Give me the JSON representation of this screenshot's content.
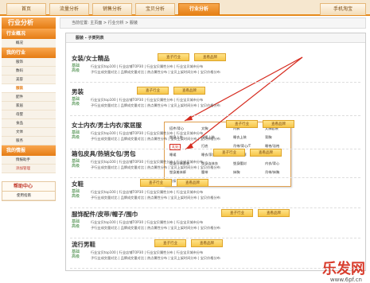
{
  "topnav": {
    "tabs": [
      {
        "label": "首页"
      },
      {
        "label": "流量分析"
      },
      {
        "label": "销售分析"
      },
      {
        "label": "宝贝分析"
      },
      {
        "label": "行业分析"
      },
      {
        "label": "手机淘宝"
      }
    ]
  },
  "breadcrumb": "当前位置: 主页面 > 行业分析 > 服装",
  "sidebar": {
    "title": "行业分析",
    "sections": [
      {
        "heading": "行业概况",
        "items": [
          "概况"
        ]
      },
      {
        "heading": "我的行业",
        "items": [
          "服饰",
          "数码",
          "美容",
          "服装",
          "配件",
          "家居",
          "母婴",
          "食品",
          "文体",
          "服务"
        ]
      },
      {
        "heading": "我的情报",
        "items": [
          "情报助手",
          "添加管理"
        ]
      }
    ],
    "help_title": "帮助中心",
    "help_link": "使用指南"
  },
  "content": {
    "title": "服装 - 子类列表",
    "industry_btn": "查子行业",
    "brand_btn": "查看品牌",
    "basic_label": "基础",
    "advanced_label": "高级",
    "row1": "行业宝贝top100 | 行业店铺TOP30 | 行业宝贝属性分布 | 行业宝贝城市分布",
    "row2": "子行业成交量对比 | 品牌成交量对比 | 热点属性分布 | 宝贝上架时间分布 | 宝贝价格分布",
    "categories": [
      {
        "name": "女装/女士精品"
      },
      {
        "name": "男装"
      },
      {
        "name": "女士内衣/男士内衣/家居服"
      },
      {
        "name": "箱包皮具/热销女包/男包"
      },
      {
        "name": "女鞋"
      },
      {
        "name": "服饰配件/皮带/帽子/围巾"
      },
      {
        "name": "流行男鞋"
      }
    ]
  },
  "dropdown": {
    "items": [
      "搭件/背心",
      "文胸",
      "内裤",
      "文胸套装",
      "塑身上衣",
      "保暖上装",
      "睡衣上装",
      "背胸",
      "乳贴",
      "打底",
      "吊带/背心/T",
      "睡袍/浴袍",
      "睡裙",
      "睡衣/家居服",
      "塑身内裤",
      "袜子",
      "塑身分体套装",
      "塑身连体衣",
      "塑身腰封",
      "内衣/背心",
      "塑身美体裤",
      "腰带",
      "抹胸",
      "吊带/抹胸",
      "吊扣"
    ],
    "highlighted": "乳贴"
  },
  "watermark": {
    "text": "乐发网",
    "url": "www.6pf.cn"
  },
  "colors": {
    "accent": "#e57c14",
    "highlight": "#d62b1f",
    "basic_text": "#2a7a2a"
  }
}
